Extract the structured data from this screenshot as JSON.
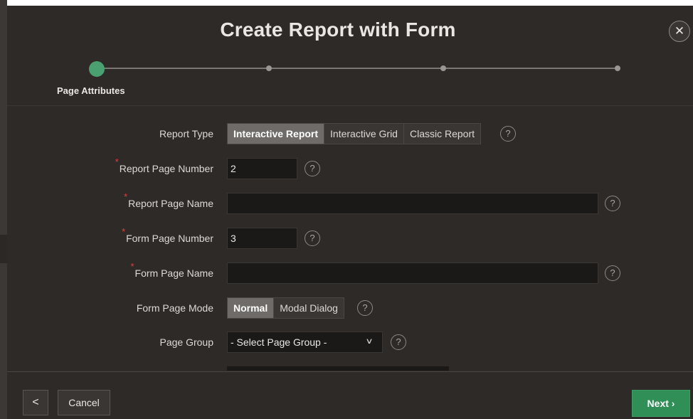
{
  "dialog": {
    "title": "Create Report with Form",
    "close_icon": "close-icon"
  },
  "wizard": {
    "current_step_label": "Page Attributes",
    "total_steps": 4,
    "current_step": 1
  },
  "form": {
    "report_type": {
      "label": "Report Type",
      "options": [
        "Interactive Report",
        "Interactive Grid",
        "Classic Report"
      ],
      "selected": "Interactive Report"
    },
    "report_page_number": {
      "label": "Report Page Number",
      "required_mark": "*",
      "value": "2"
    },
    "report_page_name": {
      "label": "Report Page Name",
      "required_mark": "*",
      "value": ""
    },
    "form_page_number": {
      "label": "Form Page Number",
      "required_mark": "*",
      "value": "3"
    },
    "form_page_name": {
      "label": "Form Page Name",
      "required_mark": "*",
      "value": ""
    },
    "form_page_mode": {
      "label": "Form Page Mode",
      "options": [
        "Normal",
        "Modal Dialog"
      ],
      "selected": "Normal"
    },
    "page_group": {
      "label": "Page Group",
      "value": "- Select Page Group -"
    },
    "help_glyph": "?"
  },
  "footer": {
    "previous_glyph": "<",
    "cancel_label": "Cancel",
    "next_label": "Next ›"
  },
  "colors": {
    "background": "#2e2a28",
    "accent_green": "#4aa070",
    "next_button": "#2f8f57",
    "required": "#e04040"
  }
}
